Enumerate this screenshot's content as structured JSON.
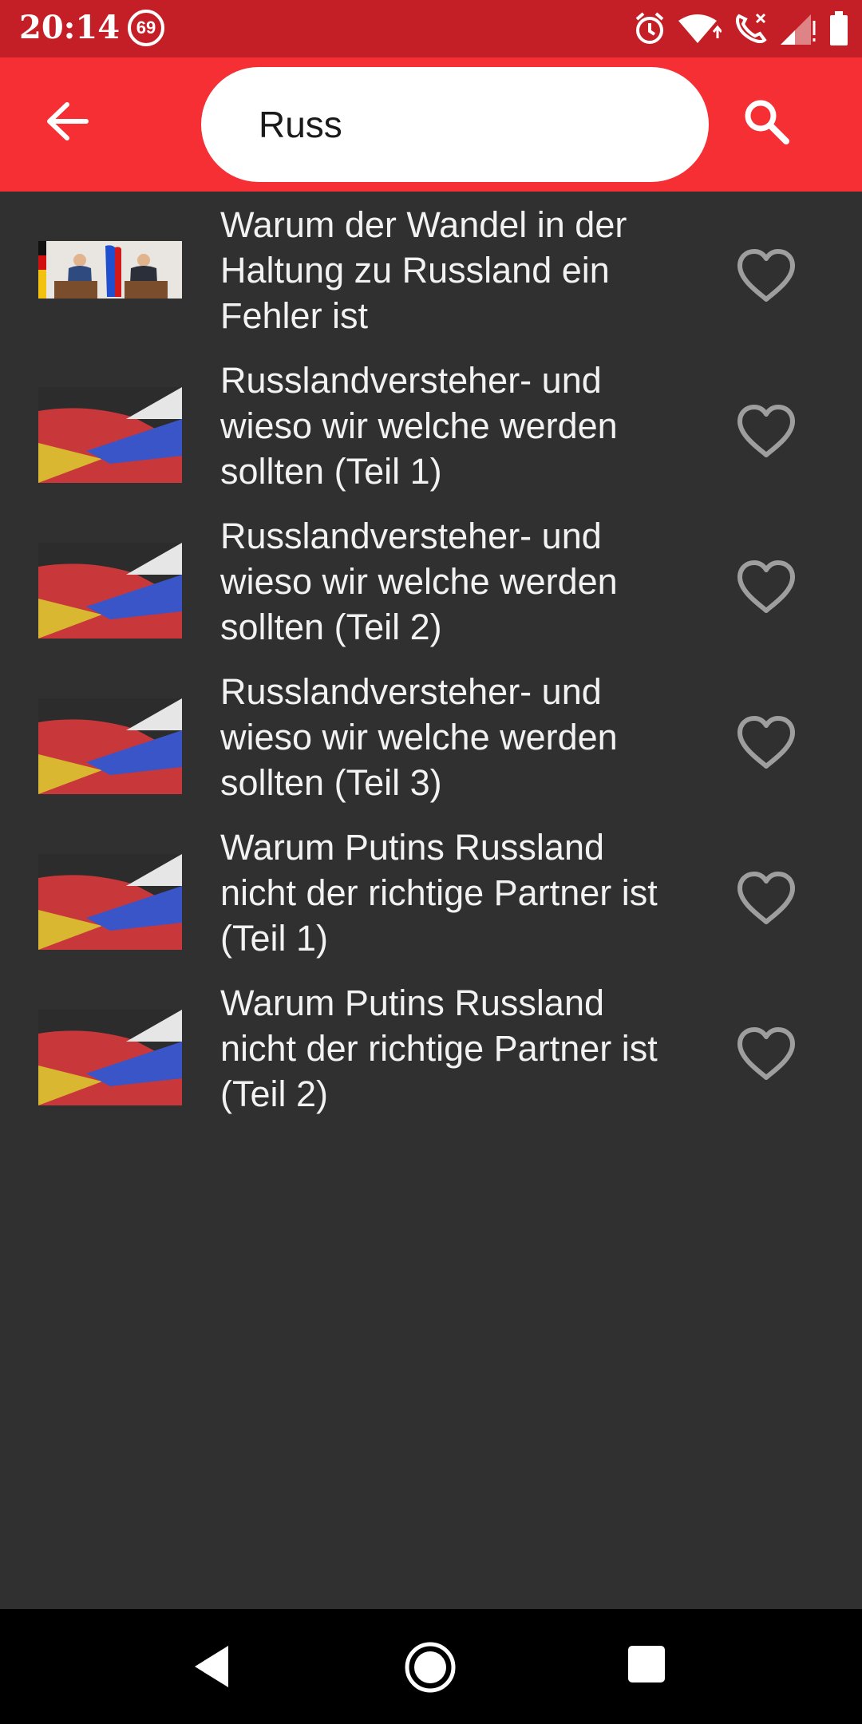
{
  "status_bar": {
    "time": "20:14",
    "badge": "69",
    "icons": [
      "alarm-icon",
      "wifi-icon",
      "call-icon",
      "signal-icon",
      "battery-icon"
    ]
  },
  "app_bar": {
    "back_icon": "arrow-back-icon",
    "search_value": "Russ",
    "search_icon": "search-icon",
    "color": "#f62f35"
  },
  "results": [
    {
      "title": "Warum der Wandel in der Haltung zu Russland ein Fehler ist",
      "thumbnail": "photo-merkel-putin",
      "favorite": false
    },
    {
      "title": "Russlandversteher- und wieso wir welche werden sollten (Teil 1)",
      "thumbnail": "flag-germany-russia",
      "favorite": false
    },
    {
      "title": "Russlandversteher- und wieso wir welche werden sollten (Teil 2)",
      "thumbnail": "flag-germany-russia",
      "favorite": false
    },
    {
      "title": "Russlandversteher- und wieso wir welche werden sollten (Teil 3)",
      "thumbnail": "flag-germany-russia",
      "favorite": false
    },
    {
      "title": "Warum Putins Russland nicht der richtige Partner ist (Teil 1)",
      "thumbnail": "flag-germany-russia",
      "favorite": false
    },
    {
      "title": "Warum Putins Russland nicht der richtige Partner ist (Teil 2)",
      "thumbnail": "flag-germany-russia",
      "favorite": false
    }
  ],
  "nav_bar": {
    "icons": [
      "nav-back-icon",
      "nav-home-icon",
      "nav-recents-icon"
    ]
  },
  "colors": {
    "status_bar": "#c41f26",
    "app_bar": "#f62f35",
    "background": "#303030",
    "text": "#f2f2f2",
    "heart": "#9e9e9e"
  }
}
